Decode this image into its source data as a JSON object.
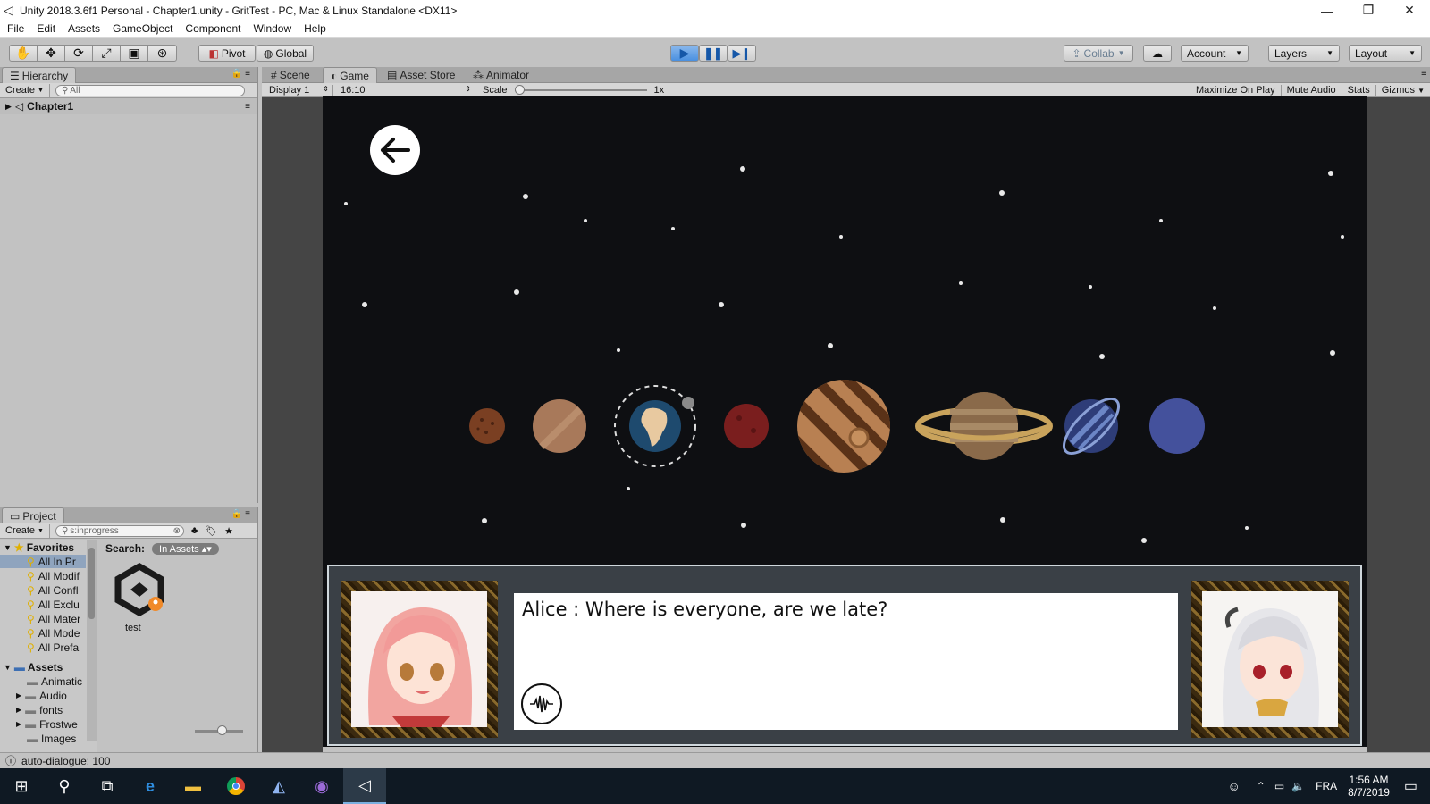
{
  "window": {
    "title": "Unity 2018.3.6f1 Personal - Chapter1.unity - GritTest - PC, Mac & Linux Standalone <DX11>",
    "minimize": "—",
    "maximize": "❐",
    "close": "✕"
  },
  "menu": [
    "File",
    "Edit",
    "Assets",
    "GameObject",
    "Component",
    "Window",
    "Help"
  ],
  "toolbar": {
    "pivot": "Pivot",
    "global": "Global",
    "collab": "Collab",
    "account": "Account",
    "layers": "Layers",
    "layout": "Layout"
  },
  "hierarchy": {
    "tab": "Hierarchy",
    "create": "Create",
    "search_placeholder": "All",
    "scene": "Chapter1"
  },
  "tabs": {
    "scene": "Scene",
    "game": "Game",
    "asset_store": "Asset Store",
    "animator": "Animator"
  },
  "game_bar": {
    "display": "Display 1",
    "aspect": "16:10",
    "scale_label": "Scale",
    "scale_value": "1x",
    "maximize": "Maximize On Play",
    "mute": "Mute Audio",
    "stats": "Stats",
    "gizmos": "Gizmos"
  },
  "project": {
    "tab": "Project",
    "create": "Create",
    "search_value": "s:inprogress",
    "search_label": "Search:",
    "search_scope": "In Assets",
    "favorites_label": "Favorites",
    "favorites": [
      "All In Pr",
      "All Modif",
      "All Confl",
      "All Exclu",
      "All Mater",
      "All Mode",
      "All Prefa"
    ],
    "assets_label": "Assets",
    "assets": [
      "Animatic",
      "Audio",
      "fonts",
      "Frostwe",
      "Images"
    ],
    "result_item": "test"
  },
  "dialogue": {
    "text": "Alice : Where is everyone, are we late?"
  },
  "status": {
    "message": "auto-dialogue: 100"
  },
  "taskbar": {
    "language": "FRA",
    "time": "1:56 AM",
    "date": "8/7/2019"
  },
  "colors": {
    "editor_bg": "#c2c2c2",
    "game_bg": "#0e0f12",
    "play_active": "#4a90e0"
  }
}
